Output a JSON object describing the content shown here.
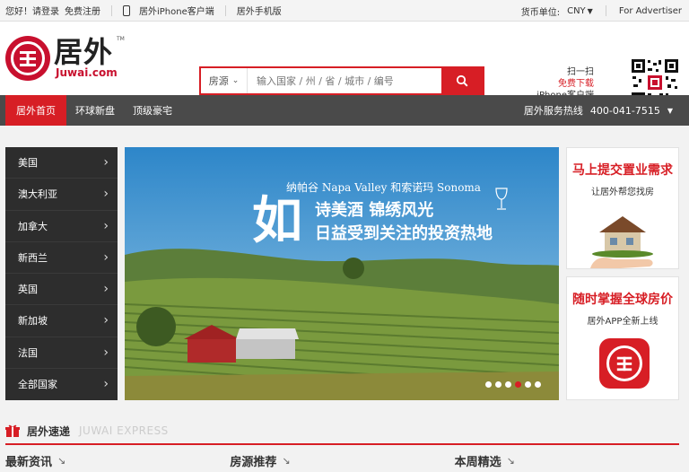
{
  "topbar": {
    "greeting": "您好！请登录",
    "register": "免费注册",
    "iphone_client": "居外iPhone客户端",
    "mobile_site": "居外手机版",
    "currency_label": "货币单位:",
    "currency_value": "CNY",
    "advertiser": "For Advertiser"
  },
  "header": {
    "logo_cn": "居外",
    "logo_en": "Juwai.com",
    "logo_tm": "TM",
    "search": {
      "category": "房源",
      "placeholder": "输入国家 / 州 / 省 / 城市 / 编号"
    },
    "app_promo": {
      "line1": "扫一扫",
      "line2": "免费下载",
      "line3": "iPhone客户端"
    }
  },
  "nav": {
    "items": [
      "居外首页",
      "环球新盘",
      "顶级豪宅"
    ],
    "hotline_label": "居外服务热线",
    "hotline_number": "400-041-7515"
  },
  "sidebar": {
    "items": [
      {
        "label": "美国"
      },
      {
        "label": "澳大利亚"
      },
      {
        "label": "加拿大"
      },
      {
        "label": "新西兰"
      },
      {
        "label": "英国"
      },
      {
        "label": "新加坡"
      },
      {
        "label": "法国"
      },
      {
        "label": "全部国家"
      }
    ]
  },
  "banner": {
    "line1": "纳帕谷 Napa Valley 和索诺玛 Sonoma",
    "big_char": "如",
    "line2": "诗美酒 锦绣风光",
    "line3": "日益受到关注的投资热地",
    "active_dot": 3,
    "dot_count": 6
  },
  "ads": {
    "ad1": {
      "title": "马上提交置业需求",
      "subtitle": "让居外帮您找房"
    },
    "ad2": {
      "title": "随时掌握全球房价",
      "subtitle": "居外APP全新上线"
    }
  },
  "express": {
    "title": "居外速递",
    "subtitle_en": "JUWAI EXPRESS"
  },
  "columns": [
    {
      "label": "最新资讯"
    },
    {
      "label": "房源推荐"
    },
    {
      "label": "本周精选"
    }
  ],
  "colors": {
    "brand_red": "#d71e25",
    "nav_bg": "#4a4a4a",
    "sidebar_bg": "#2d2d2d"
  }
}
